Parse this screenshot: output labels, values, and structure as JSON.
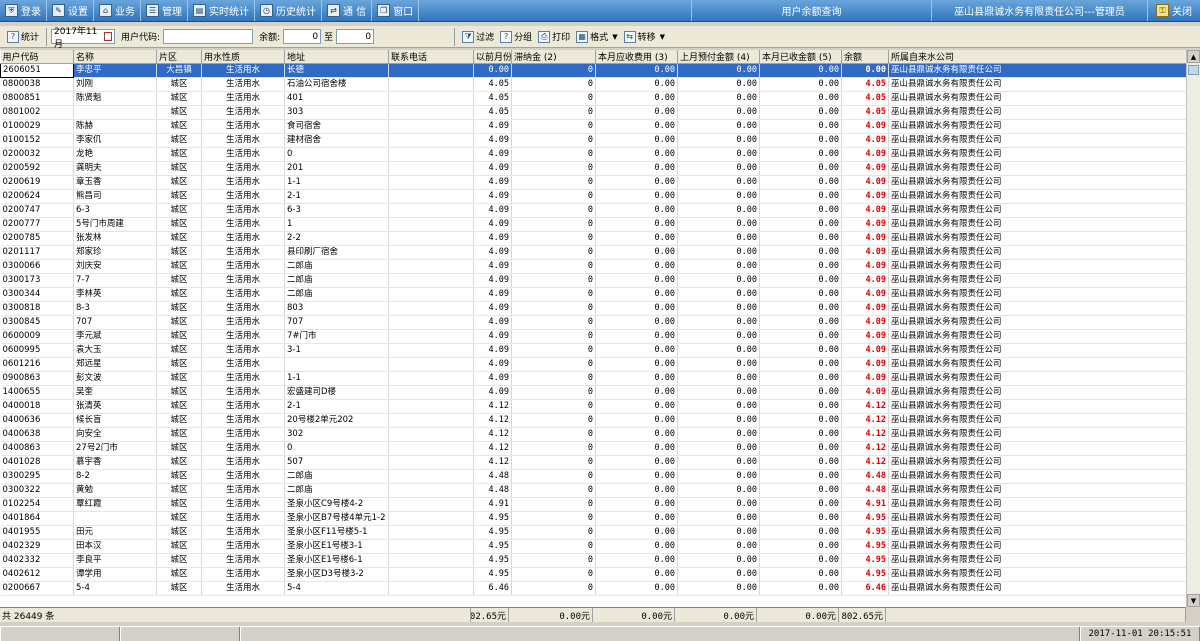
{
  "menubar": {
    "items": [
      {
        "label": "登录",
        "icon": "shield-icon",
        "glyph": "⛨"
      },
      {
        "label": "设置",
        "icon": "settings-icon",
        "glyph": "✎"
      },
      {
        "label": "业务",
        "icon": "business-icon",
        "glyph": "⌂"
      },
      {
        "label": "管理",
        "icon": "manage-icon",
        "glyph": "☰"
      },
      {
        "label": "实时统计",
        "icon": "realtime-icon",
        "glyph": "▤"
      },
      {
        "label": "历史统计",
        "icon": "history-icon",
        "glyph": "◷"
      },
      {
        "label": "通 信",
        "icon": "comm-icon",
        "glyph": "⇄"
      },
      {
        "label": "窗口",
        "icon": "window-icon",
        "glyph": "❐"
      }
    ],
    "title": "用户余额查询",
    "company_user": "巫山县鼎诚水务有限责任公司---管理员",
    "exit_label": "关闭"
  },
  "toolbar": {
    "stats_label": "统计",
    "month": "2017年11月",
    "user_code_label": "用户代码:",
    "user_code_value": "",
    "balance_label": "余额:",
    "balance_from": "0",
    "to_label": "至",
    "balance_to": "0",
    "filter_label": "过滤",
    "group_label": "分组",
    "print_label": "打印",
    "format_label": "格式",
    "transfer_label": "转移"
  },
  "table": {
    "columns": [
      "用户代码",
      "名称",
      "片区",
      "用水性质",
      "地址",
      "联系电话",
      "以前月份",
      "滞纳金 (2)",
      "本月应收费用 (3)",
      "上月预付金额 (4)",
      "本月已收金额 (5)",
      "余额",
      "所属自来水公司"
    ],
    "rows": [
      [
        "2606051",
        "李忠平",
        "大昌镇",
        "生活用水",
        "长德",
        "",
        "0.00",
        "0",
        "0.00",
        "0.00",
        "0.00",
        "0.00",
        "巫山县鼎诚水务有限责任公司"
      ],
      [
        "0800038",
        "刘刚",
        "城区",
        "生活用水",
        "石油公司宿舍楼",
        "",
        "4.05",
        "0",
        "0.00",
        "0.00",
        "0.00",
        "4.05",
        "巫山县鼎诚水务有限责任公司"
      ],
      [
        "0800851",
        "陈贤魁",
        "城区",
        "生活用水",
        "401",
        "",
        "4.05",
        "0",
        "0.00",
        "0.00",
        "0.00",
        "4.05",
        "巫山县鼎诚水务有限责任公司"
      ],
      [
        "0801002",
        "",
        "城区",
        "生活用水",
        "303",
        "",
        "4.05",
        "0",
        "0.00",
        "0.00",
        "0.00",
        "4.05",
        "巫山县鼎诚水务有限责任公司"
      ],
      [
        "0100029",
        "陈赫",
        "城区",
        "生活用水",
        "食司宿舍",
        "",
        "4.09",
        "0",
        "0.00",
        "0.00",
        "0.00",
        "4.09",
        "巫山县鼎诚水务有限责任公司"
      ],
      [
        "0100152",
        "李家仉",
        "城区",
        "生活用水",
        "建材宿舍",
        "",
        "4.09",
        "0",
        "0.00",
        "0.00",
        "0.00",
        "4.09",
        "巫山县鼎诚水务有限责任公司"
      ],
      [
        "0200032",
        "龙艳",
        "城区",
        "生活用水",
        "0",
        "",
        "4.09",
        "0",
        "0.00",
        "0.00",
        "0.00",
        "4.09",
        "巫山县鼎诚水务有限责任公司"
      ],
      [
        "0200592",
        "龚明夫",
        "城区",
        "生活用水",
        "201",
        "",
        "4.09",
        "0",
        "0.00",
        "0.00",
        "0.00",
        "4.09",
        "巫山县鼎诚水务有限责任公司"
      ],
      [
        "0200619",
        "章玉香",
        "城区",
        "生活用水",
        "1-1",
        "",
        "4.09",
        "0",
        "0.00",
        "0.00",
        "0.00",
        "4.09",
        "巫山县鼎诚水务有限责任公司"
      ],
      [
        "0200624",
        "熊昌司",
        "城区",
        "生活用水",
        "2-1",
        "",
        "4.09",
        "0",
        "0.00",
        "0.00",
        "0.00",
        "4.09",
        "巫山县鼎诚水务有限责任公司"
      ],
      [
        "0200747",
        "6-3",
        "城区",
        "生活用水",
        "6-3",
        "",
        "4.09",
        "0",
        "0.00",
        "0.00",
        "0.00",
        "4.09",
        "巫山县鼎诚水务有限责任公司"
      ],
      [
        "0200777",
        "5号门市周建",
        "城区",
        "生活用水",
        "1",
        "",
        "4.09",
        "0",
        "0.00",
        "0.00",
        "0.00",
        "4.09",
        "巫山县鼎诚水务有限责任公司"
      ],
      [
        "0200785",
        "张发林",
        "城区",
        "生活用水",
        "2-2",
        "",
        "4.09",
        "0",
        "0.00",
        "0.00",
        "0.00",
        "4.09",
        "巫山县鼎诚水务有限责任公司"
      ],
      [
        "0201117",
        "郑家珍",
        "城区",
        "生活用水",
        "县印刷厂宿舍",
        "",
        "4.09",
        "0",
        "0.00",
        "0.00",
        "0.00",
        "4.09",
        "巫山县鼎诚水务有限责任公司"
      ],
      [
        "0300066",
        "刘庆安",
        "城区",
        "生活用水",
        "二郎庙",
        "",
        "4.09",
        "0",
        "0.00",
        "0.00",
        "0.00",
        "4.09",
        "巫山县鼎诚水务有限责任公司"
      ],
      [
        "0300173",
        "7-7",
        "城区",
        "生活用水",
        "二郎庙",
        "",
        "4.09",
        "0",
        "0.00",
        "0.00",
        "0.00",
        "4.09",
        "巫山县鼎诚水务有限责任公司"
      ],
      [
        "0300344",
        "李林英",
        "城区",
        "生活用水",
        "二郎庙",
        "",
        "4.09",
        "0",
        "0.00",
        "0.00",
        "0.00",
        "4.09",
        "巫山县鼎诚水务有限责任公司"
      ],
      [
        "0300818",
        "8-3",
        "城区",
        "生活用水",
        "803",
        "",
        "4.09",
        "0",
        "0.00",
        "0.00",
        "0.00",
        "4.09",
        "巫山县鼎诚水务有限责任公司"
      ],
      [
        "0300845",
        "707",
        "城区",
        "生活用水",
        "707",
        "",
        "4.09",
        "0",
        "0.00",
        "0.00",
        "0.00",
        "4.09",
        "巫山县鼎诚水务有限责任公司"
      ],
      [
        "0600009",
        "李元斌",
        "城区",
        "生活用水",
        "7#门市",
        "",
        "4.09",
        "0",
        "0.00",
        "0.00",
        "0.00",
        "4.09",
        "巫山县鼎诚水务有限责任公司"
      ],
      [
        "0600995",
        "袁大玉",
        "城区",
        "生活用水",
        "3-1",
        "",
        "4.09",
        "0",
        "0.00",
        "0.00",
        "0.00",
        "4.09",
        "巫山县鼎诚水务有限责任公司"
      ],
      [
        "0601216",
        "郑远星",
        "城区",
        "生活用水",
        "",
        "",
        "4.09",
        "0",
        "0.00",
        "0.00",
        "0.00",
        "4.09",
        "巫山县鼎诚水务有限责任公司"
      ],
      [
        "0900863",
        "彭文波",
        "城区",
        "生活用水",
        "1-1",
        "",
        "4.09",
        "0",
        "0.00",
        "0.00",
        "0.00",
        "4.09",
        "巫山县鼎诚水务有限责任公司"
      ],
      [
        "1400655",
        "吴奎",
        "城区",
        "生活用水",
        "宏盛建司D楼",
        "",
        "4.09",
        "0",
        "0.00",
        "0.00",
        "0.00",
        "4.09",
        "巫山县鼎诚水务有限责任公司"
      ],
      [
        "0400018",
        "张清英",
        "城区",
        "生活用水",
        "2-1",
        "",
        "4.12",
        "0",
        "0.00",
        "0.00",
        "0.00",
        "4.12",
        "巫山县鼎诚水务有限责任公司"
      ],
      [
        "0400636",
        "候长盲",
        "城区",
        "生活用水",
        "20号楼2单元202",
        "",
        "4.12",
        "0",
        "0.00",
        "0.00",
        "0.00",
        "4.12",
        "巫山县鼎诚水务有限责任公司"
      ],
      [
        "0400638",
        "向安全",
        "城区",
        "生活用水",
        "302",
        "",
        "4.12",
        "0",
        "0.00",
        "0.00",
        "0.00",
        "4.12",
        "巫山县鼎诚水务有限责任公司"
      ],
      [
        "0400863",
        "27号2门市",
        "城区",
        "生活用水",
        "0",
        "",
        "4.12",
        "0",
        "0.00",
        "0.00",
        "0.00",
        "4.12",
        "巫山县鼎诚水务有限责任公司"
      ],
      [
        "0401028",
        "慕宇香",
        "城区",
        "生活用水",
        "507",
        "",
        "4.12",
        "0",
        "0.00",
        "0.00",
        "0.00",
        "4.12",
        "巫山县鼎诚水务有限责任公司"
      ],
      [
        "0300295",
        "8-2",
        "城区",
        "生活用水",
        "二郎庙",
        "",
        "4.48",
        "0",
        "0.00",
        "0.00",
        "0.00",
        "4.48",
        "巫山县鼎诚水务有限责任公司"
      ],
      [
        "0300322",
        "黄勉",
        "城区",
        "生活用水",
        "二郎庙",
        "",
        "4.48",
        "0",
        "0.00",
        "0.00",
        "0.00",
        "4.48",
        "巫山县鼎诚水务有限责任公司"
      ],
      [
        "0102254",
        "覃红霞",
        "城区",
        "生活用水",
        "圣泉小区C9号楼4-2",
        "",
        "4.91",
        "0",
        "0.00",
        "0.00",
        "0.00",
        "4.91",
        "巫山县鼎诚水务有限责任公司"
      ],
      [
        "0401864",
        "",
        "城区",
        "生活用水",
        "圣泉小区B7号楼4单元1-2",
        "",
        "4.95",
        "0",
        "0.00",
        "0.00",
        "0.00",
        "4.95",
        "巫山县鼎诚水务有限责任公司"
      ],
      [
        "0401955",
        "田元",
        "城区",
        "生活用水",
        "圣泉小区F11号楼5-1",
        "",
        "4.95",
        "0",
        "0.00",
        "0.00",
        "0.00",
        "4.95",
        "巫山县鼎诚水务有限责任公司"
      ],
      [
        "0402329",
        "田本汉",
        "城区",
        "生活用水",
        "圣泉小区E1号楼3-1",
        "",
        "4.95",
        "0",
        "0.00",
        "0.00",
        "0.00",
        "4.95",
        "巫山县鼎诚水务有限责任公司"
      ],
      [
        "0402332",
        "李良平",
        "城区",
        "生活用水",
        "圣泉小区E1号楼6-1",
        "",
        "4.95",
        "0",
        "0.00",
        "0.00",
        "0.00",
        "4.95",
        "巫山县鼎诚水务有限责任公司"
      ],
      [
        "0402612",
        "谭学用",
        "城区",
        "生活用水",
        "圣泉小区D3号楼3-2",
        "",
        "4.95",
        "0",
        "0.00",
        "0.00",
        "0.00",
        "4.95",
        "巫山县鼎诚水务有限责任公司"
      ],
      [
        "0200667",
        "5-4",
        "城区",
        "生活用水",
        "5-4",
        "",
        "6.46",
        "0",
        "0.00",
        "0.00",
        "0.00",
        "6.46",
        "巫山县鼎诚水务有限责任公司"
      ]
    ]
  },
  "footer": {
    "count_label": "共 26449 条",
    "prev_total": "302.65元",
    "late_fee_total": "0.00元",
    "due_total": "0.00元",
    "prepaid_total": "0.00元",
    "received_total": "0.00元",
    "balance_total": "802.65元"
  },
  "statusbar": {
    "datetime": "2017-11-01 20:15:51"
  },
  "colors": {
    "menubar": "#2f74bd",
    "selection": "#316ac5",
    "balance_text": "#e00000"
  }
}
